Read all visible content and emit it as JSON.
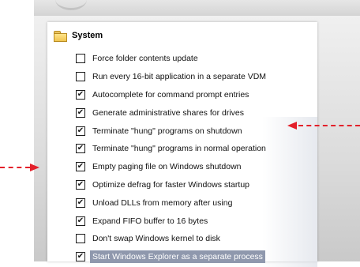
{
  "group": {
    "label": "System",
    "icon": "folder-open-icon"
  },
  "options": [
    {
      "label": "Force folder contents update",
      "checked": false,
      "selected": false
    },
    {
      "label": "Run every 16-bit application in a separate VDM",
      "checked": false,
      "selected": false
    },
    {
      "label": "Autocomplete for command prompt entries",
      "checked": true,
      "selected": false
    },
    {
      "label": "Generate administrative shares for drives",
      "checked": true,
      "selected": false
    },
    {
      "label": "Terminate \"hung\" programs on shutdown",
      "checked": true,
      "selected": false
    },
    {
      "label": "Terminate \"hung\" programs in normal operation",
      "checked": true,
      "selected": false
    },
    {
      "label": "Empty paging file on Windows shutdown",
      "checked": true,
      "selected": false
    },
    {
      "label": "Optimize defrag for faster Windows startup",
      "checked": true,
      "selected": false
    },
    {
      "label": "Unload DLLs from memory after using",
      "checked": true,
      "selected": false
    },
    {
      "label": "Expand FIFO buffer to 16 bytes",
      "checked": true,
      "selected": false
    },
    {
      "label": "Don't swap Windows kernel to disk",
      "checked": false,
      "selected": false
    },
    {
      "label": "Start Windows Explorer as a separate process",
      "checked": true,
      "selected": true
    }
  ],
  "check_glyph": "✔",
  "colors": {
    "arrow": "#e3202a",
    "selection": "#8f98ad"
  }
}
